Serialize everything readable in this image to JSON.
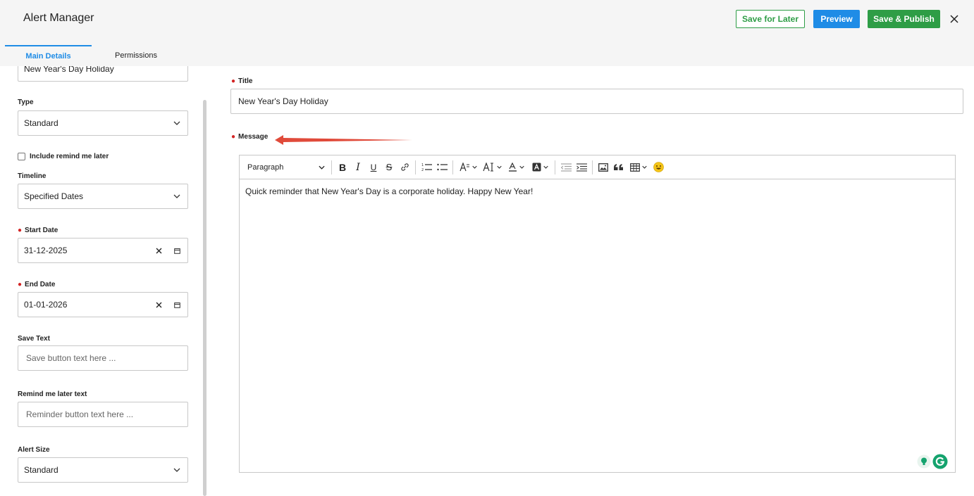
{
  "header": {
    "title": "Alert Manager",
    "save_later_label": "Save for Later",
    "preview_label": "Preview",
    "publish_label": "Save & Publish",
    "close_glyph": "✕"
  },
  "tabs": [
    {
      "label": "Main Details",
      "active": true
    },
    {
      "label": "Permissions",
      "active": false
    }
  ],
  "left": {
    "top_input_value": "New Year's Day Holiday",
    "type": {
      "label": "Type",
      "value": "Standard"
    },
    "remind_checkbox": {
      "label": "Include remind me later",
      "checked": false
    },
    "timeline": {
      "label": "Timeline",
      "value": "Specified Dates"
    },
    "start_date": {
      "label": "Start Date",
      "value": "31-12-2025"
    },
    "end_date": {
      "label": "End Date",
      "value": "01-01-2026"
    },
    "save_text": {
      "label": "Save Text",
      "placeholder": "Save button text here ..."
    },
    "remind_text": {
      "label": "Remind me later text",
      "placeholder": "Reminder button text here ..."
    },
    "alert_size": {
      "label": "Alert Size",
      "value": "Standard"
    }
  },
  "right": {
    "title_label": "Title",
    "title_value": "New Year's Day Holiday",
    "message_label": "Message",
    "toolbar": {
      "paragraph": "Paragraph",
      "bold": "B",
      "italic": "I",
      "underline": "U",
      "strike": "S"
    },
    "message_body": "Quick reminder that New Year's Day is a corporate holiday. Happy New Year!"
  },
  "colors": {
    "accent_blue": "#1f8ce6",
    "accent_green": "#2e9d46",
    "required_red": "#d32424",
    "annotation_arrow": "#e04a3a"
  }
}
